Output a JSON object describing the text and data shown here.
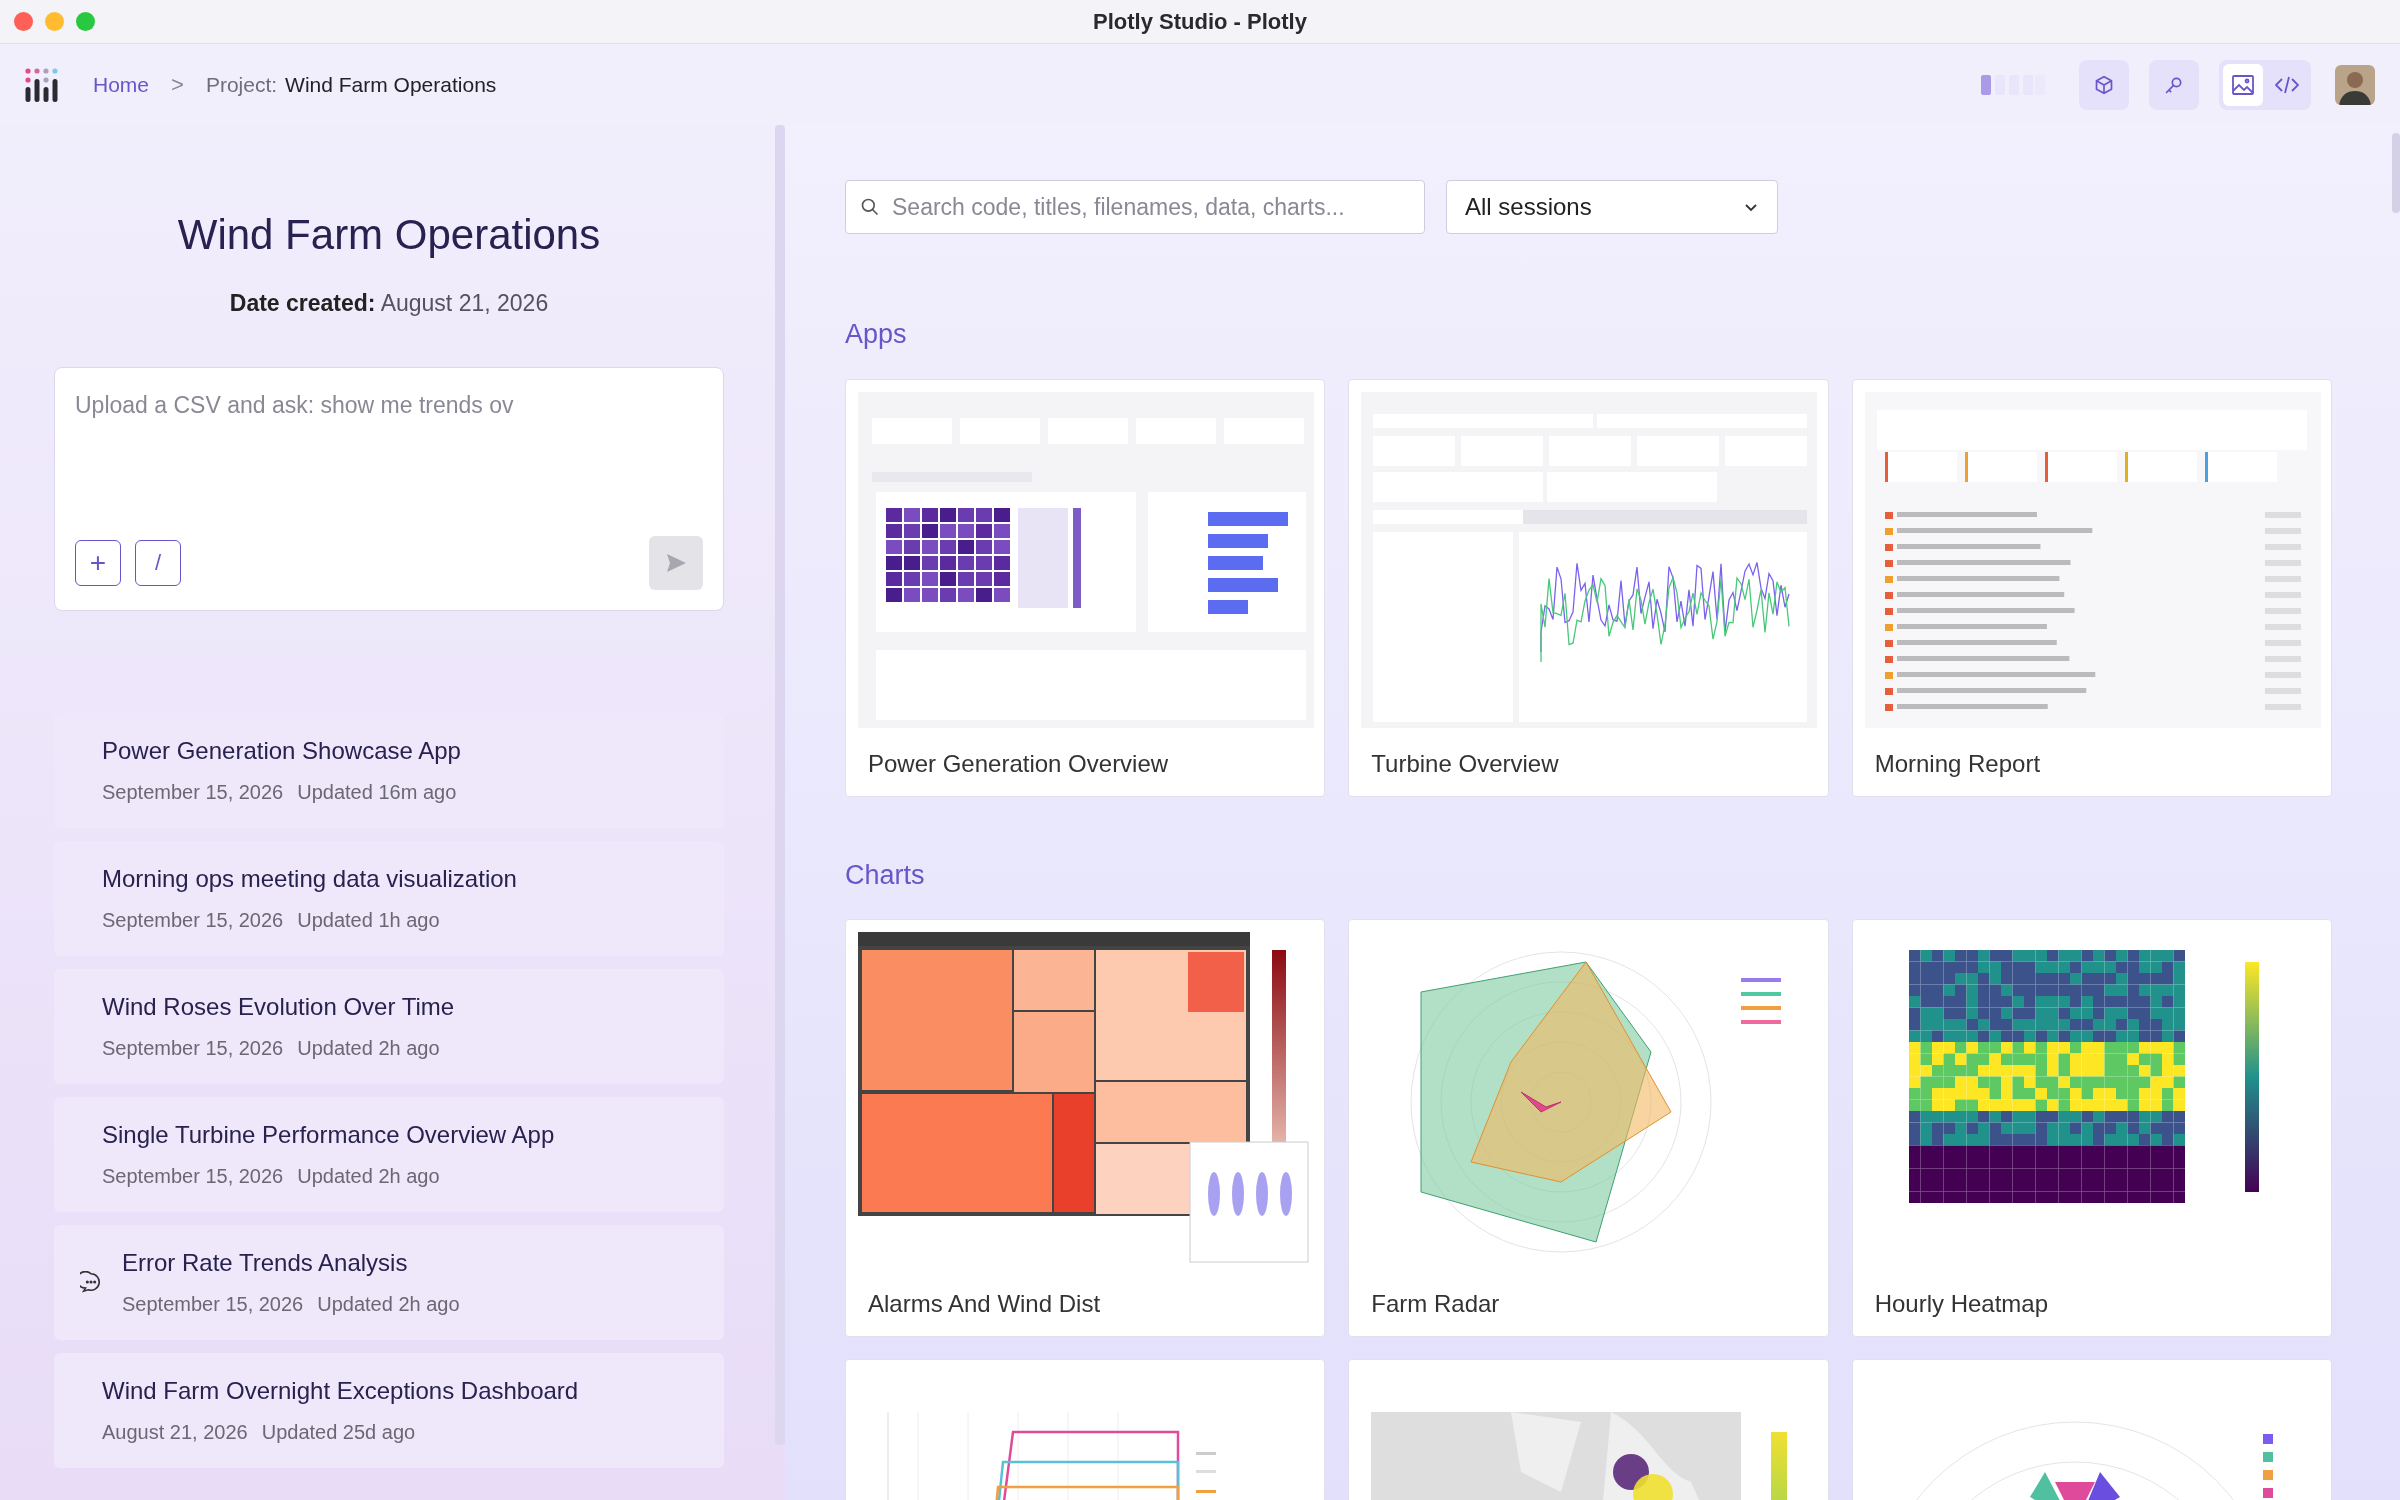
{
  "window": {
    "title": "Plotly Studio - Plotly"
  },
  "breadcrumb": {
    "home": "Home",
    "separator": ">",
    "project_label": "Project:",
    "project_name": "Wind Farm Operations"
  },
  "view_toggle": [
    {
      "kind": "image",
      "selected": true
    },
    {
      "kind": "code",
      "selected": false
    }
  ],
  "project": {
    "title": "Wind Farm Operations",
    "date_label": "Date created:",
    "date": "August 21, 2026"
  },
  "prompt": {
    "placeholder": "Upload a CSV and ask: show me trends ov",
    "add": "+",
    "command": "/"
  },
  "sessions": [
    {
      "kind": "plain",
      "title": "Power Generation Showcase App",
      "date": "September 15, 2026",
      "updated": "Updated 16m ago"
    },
    {
      "kind": "plain",
      "title": "Morning ops meeting data visualization",
      "date": "September 15, 2026",
      "updated": "Updated 1h ago"
    },
    {
      "kind": "plain",
      "title": "Wind Roses Evolution Over Time",
      "date": "September 15, 2026",
      "updated": "Updated 2h ago"
    },
    {
      "kind": "plain",
      "title": "Single Turbine Performance Overview App",
      "date": "September 15, 2026",
      "updated": "Updated 2h ago"
    },
    {
      "kind": "chat",
      "title": "Error Rate Trends Analysis",
      "date": "September 15, 2026",
      "updated": "Updated 2h ago"
    },
    {
      "kind": "plain",
      "title": "Wind Farm Overnight Exceptions Dashboard",
      "date": "August 21, 2026",
      "updated": "Updated 25d ago"
    }
  ],
  "search": {
    "placeholder": "Search code, titles, filenames, data, charts..."
  },
  "session_filter": {
    "value": "All sessions"
  },
  "sections": [
    {
      "title": "Apps",
      "cards": [
        {
          "kind": "dashboard",
          "title": "Power Generation Overview"
        },
        {
          "kind": "turbine",
          "title": "Turbine Overview"
        },
        {
          "kind": "report",
          "title": "Morning Report"
        }
      ]
    },
    {
      "title": "Charts",
      "cards": [
        {
          "kind": "treemap",
          "title": "Alarms And Wind Dist"
        },
        {
          "kind": "radar",
          "title": "Farm Radar"
        },
        {
          "kind": "heatmap",
          "title": "Hourly Heatmap"
        },
        {
          "kind": "lines"
        },
        {
          "kind": "map"
        },
        {
          "kind": "polar"
        }
      ]
    }
  ]
}
